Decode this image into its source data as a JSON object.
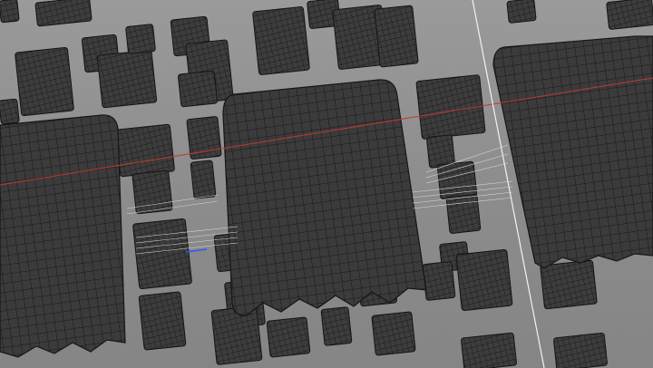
{
  "viewport": {
    "kind": "3d-wireframe-viewport",
    "background_color": "#8e8e8e",
    "mesh_fill_color": "#3a3a3a",
    "mesh_wire_color": "#1c1c1c",
    "horizon_axis_color": "#c0392b",
    "vertical_axis_color": "#f2f2f2",
    "depth_axis_color": "#3355ff"
  }
}
